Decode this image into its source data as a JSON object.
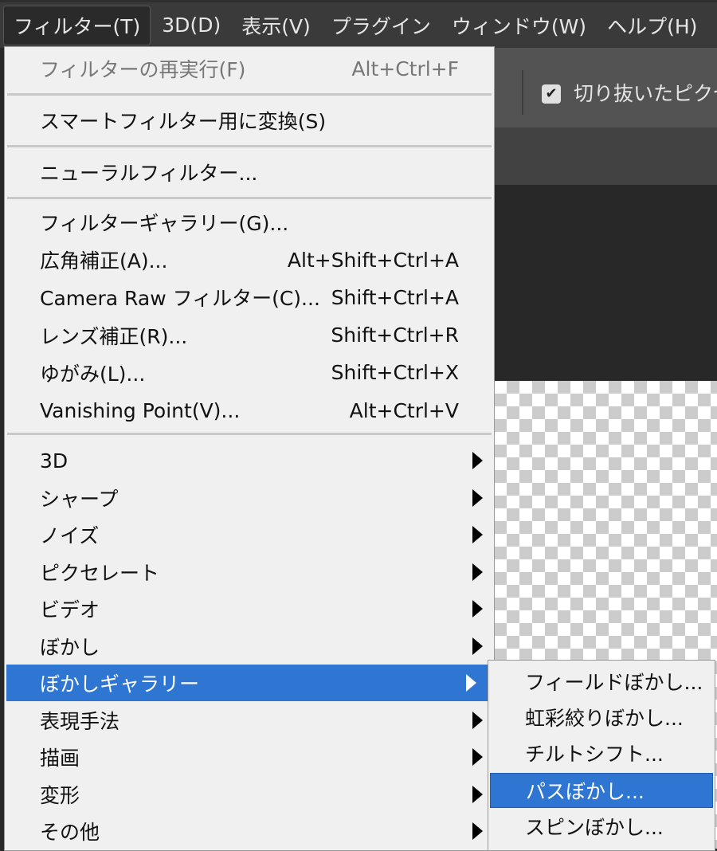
{
  "menubar": [
    "フィルター(T)",
    "3D(D)",
    "表示(V)",
    "プラグイン",
    "ウィンドウ(W)",
    "ヘルプ(H)"
  ],
  "toolbar": {
    "checkbox_label": "切り抜いたピクセル",
    "checked": true
  },
  "menu": {
    "top": [
      {
        "label": "フィルターの再実行(F)",
        "shortcut": "Alt+Ctrl+F",
        "disabled": true
      },
      {
        "label": "スマートフィルター用に変換(S)",
        "shortcut": ""
      },
      {
        "label": "ニューラルフィルター...",
        "shortcut": ""
      }
    ],
    "filters": [
      {
        "label": "フィルターギャラリー(G)...",
        "shortcut": ""
      },
      {
        "label": "広角補正(A)...",
        "shortcut": "Alt+Shift+Ctrl+A"
      },
      {
        "label": "Camera Raw フィルター(C)...",
        "shortcut": "Shift+Ctrl+A"
      },
      {
        "label": "レンズ補正(R)...",
        "shortcut": "Shift+Ctrl+R"
      },
      {
        "label": "ゆがみ(L)...",
        "shortcut": "Shift+Ctrl+X"
      },
      {
        "label": "Vanishing Point(V)...",
        "shortcut": "Alt+Ctrl+V"
      }
    ],
    "submenus": [
      "3D",
      "シャープ",
      "ノイズ",
      "ピクセレート",
      "ビデオ",
      "ぼかし",
      "ぼかしギャラリー",
      "表現手法",
      "描画",
      "変形",
      "その他"
    ],
    "highlighted": "ぼかしギャラリー"
  },
  "submenu": {
    "items": [
      "フィールドぼかし...",
      "虹彩絞りぼかし...",
      "チルトシフト...",
      "パスぼかし...",
      "スピンぼかし..."
    ],
    "highlighted": "パスぼかし..."
  }
}
